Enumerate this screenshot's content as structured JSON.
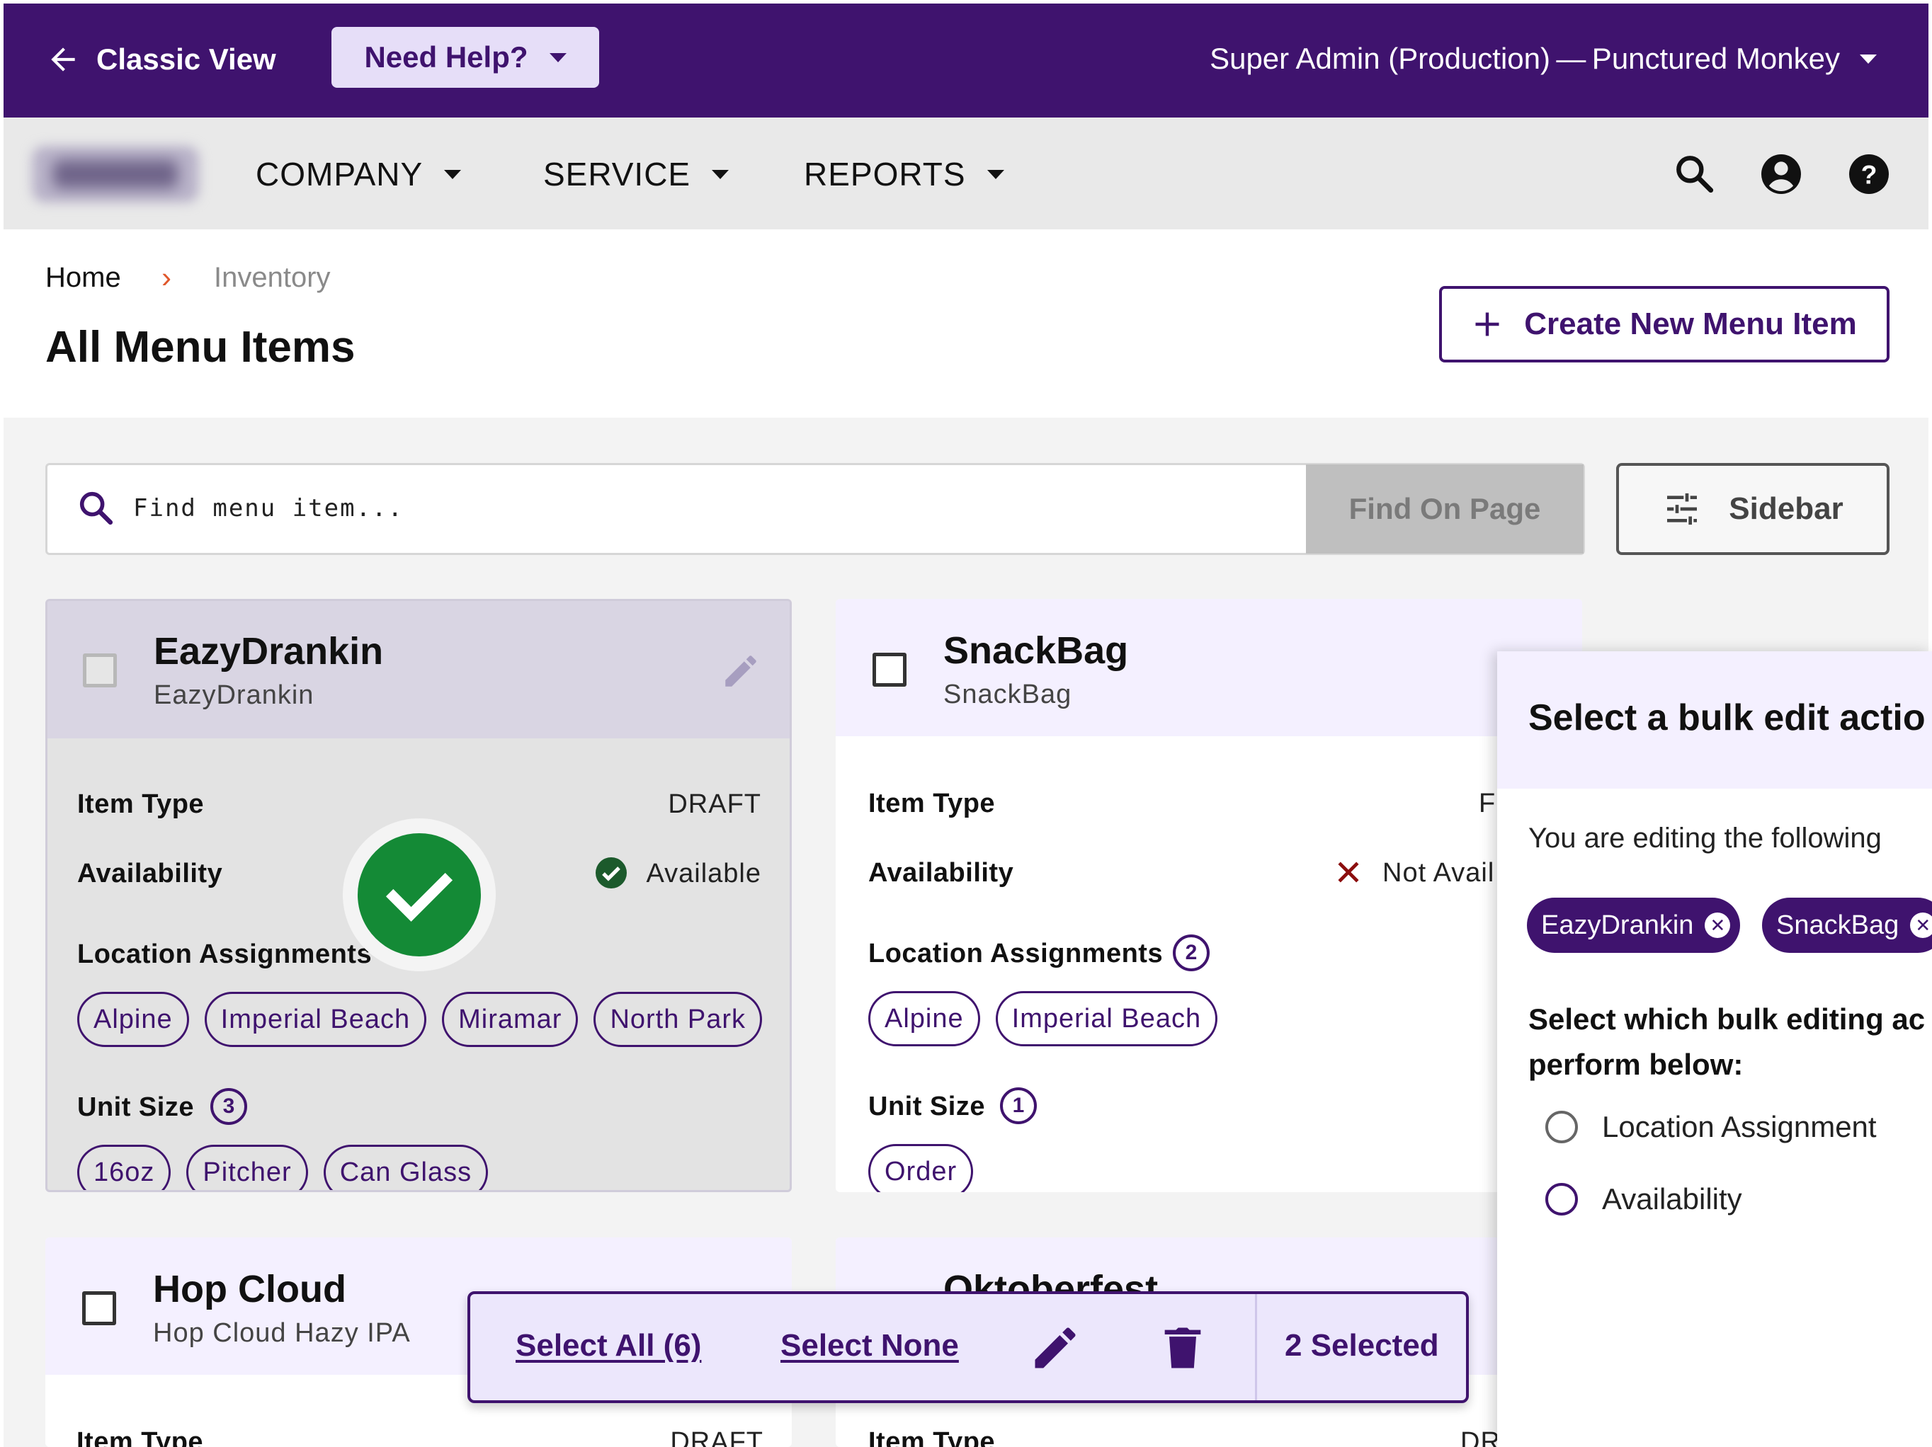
{
  "topbar": {
    "classic_view": "Classic View",
    "need_help": "Need Help?",
    "account": "Super Admin (Production) — Punctured Monkey"
  },
  "nav": {
    "items": [
      "COMPANY",
      "SERVICE",
      "REPORTS"
    ]
  },
  "header": {
    "breadcrumb_home": "Home",
    "breadcrumb_separator": "›",
    "breadcrumb_current": "Inventory",
    "title": "All Menu Items",
    "create_button": "Create New Menu Item"
  },
  "search": {
    "placeholder": "Find menu item...",
    "find_button": "Find On Page",
    "sidebar_button": "Sidebar"
  },
  "cards": [
    {
      "title": "EazyDrankin",
      "subtitle": "EazyDrankin",
      "item_type_label": "Item Type",
      "item_type": "DRAFT",
      "availability_label": "Availability",
      "availability": "Available",
      "locations_label": "Location Assignments",
      "locations": [
        "Alpine",
        "Imperial Beach",
        "Miramar",
        "North Park"
      ],
      "unit_label": "Unit Size",
      "unit_count": "3",
      "units": [
        "16oz",
        "Pitcher",
        "Can Glass"
      ],
      "selected": true
    },
    {
      "title": "SnackBag",
      "subtitle": "SnackBag",
      "item_type_label": "Item Type",
      "item_type": "F",
      "availability_label": "Availability",
      "availability": "Not Avail",
      "locations_label": "Location Assignments",
      "location_count": "2",
      "locations": [
        "Alpine",
        "Imperial Beach"
      ],
      "unit_label": "Unit Size",
      "unit_count": "1",
      "units": [
        "Order"
      ],
      "selected": false
    },
    {
      "title": "Hop Cloud",
      "subtitle": "Hop Cloud Hazy IPA",
      "item_type_label": "Item Type",
      "item_type": "DRAFT",
      "selected": false
    },
    {
      "title": "Oktoberfest",
      "item_type_label": "Item Type",
      "item_type": "DR",
      "selected": false
    }
  ],
  "bulk_panel": {
    "title": "Select a bulk edit actio",
    "editing_text": "You are editing the following",
    "selected_items": [
      "EazyDrankin",
      "SnackBag"
    ],
    "question_line1": "Select which bulk editing ac",
    "question_line2": "perform below:",
    "options": [
      "Location Assignment",
      "Availability"
    ]
  },
  "action_bar": {
    "select_all": "Select All (6)",
    "select_none": "Select None",
    "selected_count": "2 Selected"
  },
  "colors": {
    "brand_purple": "#3f136e",
    "success_green": "#148a36",
    "error_red": "#8b0d0d",
    "accent_orange": "#e0572b"
  }
}
